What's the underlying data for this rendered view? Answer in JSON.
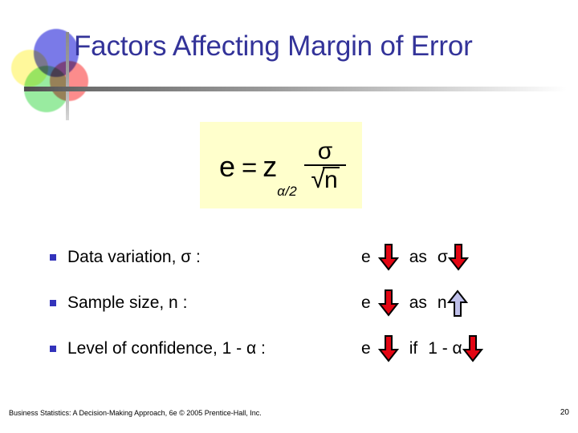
{
  "slide": {
    "title": "Factors Affecting Margin of Error",
    "title_color": "#333399",
    "background": "#ffffff"
  },
  "logo": {
    "name": "decorative-circles-logo",
    "circles": [
      {
        "name": "blue-circle",
        "color": "#5555e1"
      },
      {
        "name": "yellow-circle",
        "color": "#fff682"
      },
      {
        "name": "green-circle",
        "color": "#69e173"
      },
      {
        "name": "red-circle",
        "color": "#fa4646"
      }
    ]
  },
  "formula": {
    "background": "#ffffcc",
    "e": "e",
    "equals": "=",
    "z": "z",
    "subscript": "α/2",
    "numerator": "σ",
    "radical": "√",
    "radicand": "n",
    "plain_text": "e = zα/2 σ/√n"
  },
  "bullets": [
    {
      "label": "Data variation, σ :",
      "effect_var": "e",
      "effect_arrow": "down-arrow-red",
      "connector": "as",
      "factor_symbol": "σ",
      "factor_arrow": "down-arrow-red"
    },
    {
      "label": "Sample size, n :",
      "effect_var": "e",
      "effect_arrow": "down-arrow-red",
      "connector": "as",
      "factor_symbol": "n",
      "factor_arrow": "up-arrow-blue"
    },
    {
      "label": "Level of confidence, 1 - α :",
      "effect_var": "e",
      "effect_arrow": "down-arrow-red",
      "connector": "if",
      "factor_symbol": "1 - α",
      "factor_arrow": "down-arrow-red"
    }
  ],
  "colors": {
    "arrow_down": "#e30613",
    "arrow_up": "#bfc0ea",
    "arrow_outline": "#000000",
    "bullet_square": "#3333bb"
  },
  "footer": {
    "credit": "Business Statistics: A Decision-Making Approach, 6e © 2005 Prentice-Hall, Inc.",
    "page_number": "20"
  }
}
